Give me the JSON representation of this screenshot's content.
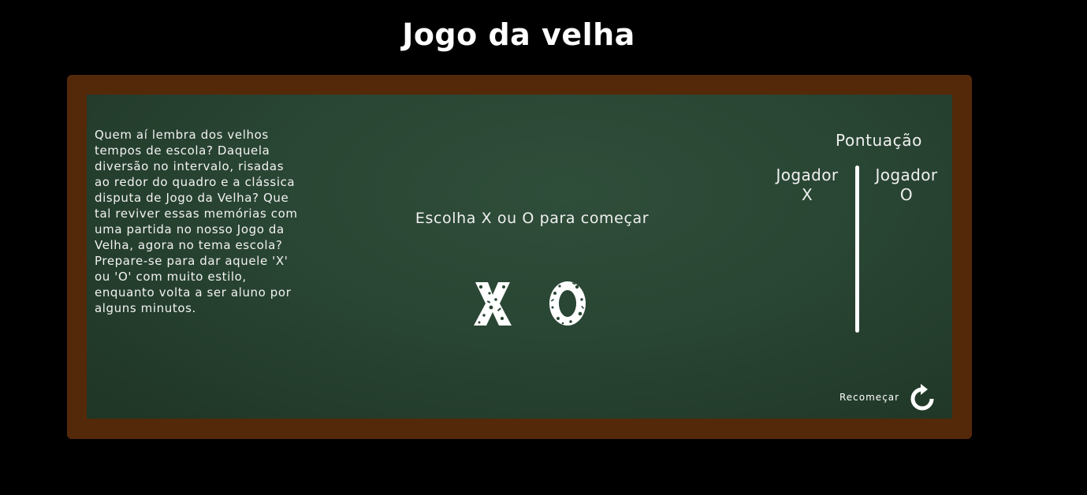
{
  "page": {
    "title": "Jogo da velha"
  },
  "intro": {
    "text": "Quem aí lembra dos velhos tempos de escola? Daquela diversão no intervalo, risadas ao redor do quadro e a clássica disputa de Jogo da Velha? Que tal reviver essas memórias com uma partida no nosso Jogo da Velha, agora no tema escola? Prepare-se para dar aquele 'X' ou 'O' com muito estilo, enquanto volta a ser aluno por alguns minutos."
  },
  "game": {
    "prompt": "Escolha X ou O para começar",
    "choices": [
      {
        "label": "X",
        "icon": "chalk-x-icon"
      },
      {
        "label": "O",
        "icon": "chalk-o-icon"
      }
    ]
  },
  "score": {
    "title": "Pontuação",
    "players": [
      {
        "name": "Jogador",
        "symbol": "X"
      },
      {
        "name": "Jogador",
        "symbol": "O"
      }
    ]
  },
  "controls": {
    "restart_label": "Recomeçar",
    "restart_icon": "restart-icon"
  },
  "colors": {
    "background": "#000000",
    "frame": "#54290a",
    "chalkboard": "#294533",
    "chalk": "#ffffff"
  }
}
